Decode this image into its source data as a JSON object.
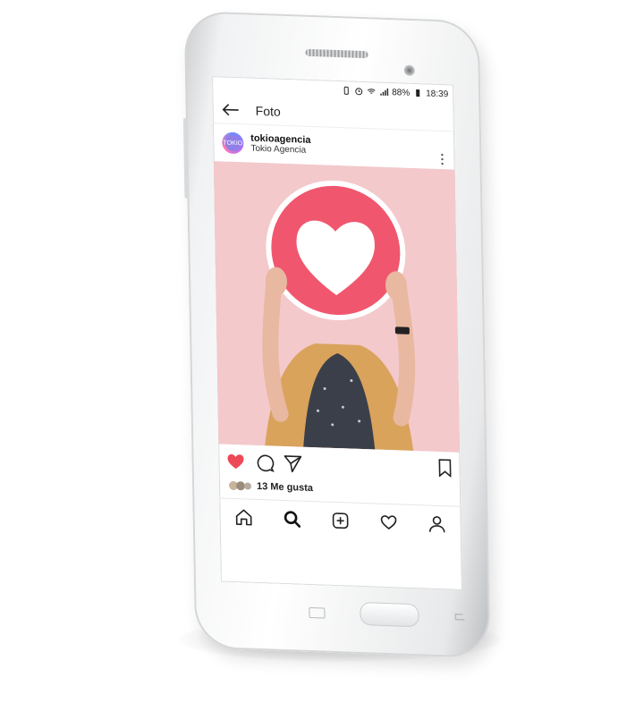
{
  "statusbar": {
    "battery_percent": "88%",
    "time": "18:39"
  },
  "topbar": {
    "title": "Foto"
  },
  "post": {
    "username": "tokioagencia",
    "display_name": "Tokio Agencia",
    "avatar_text": "TOKIO"
  },
  "likes": {
    "label": "13 Me gusta"
  },
  "colors": {
    "heart_red": "#ed4956",
    "photo_bg": "#f3c9cc",
    "badge_pink": "#f0576f"
  },
  "icons": {
    "actions": [
      "heart-icon",
      "comment-icon",
      "share-icon",
      "bookmark-icon"
    ],
    "nav": [
      "home-icon",
      "search-icon",
      "add-icon",
      "activity-icon",
      "profile-icon"
    ]
  }
}
